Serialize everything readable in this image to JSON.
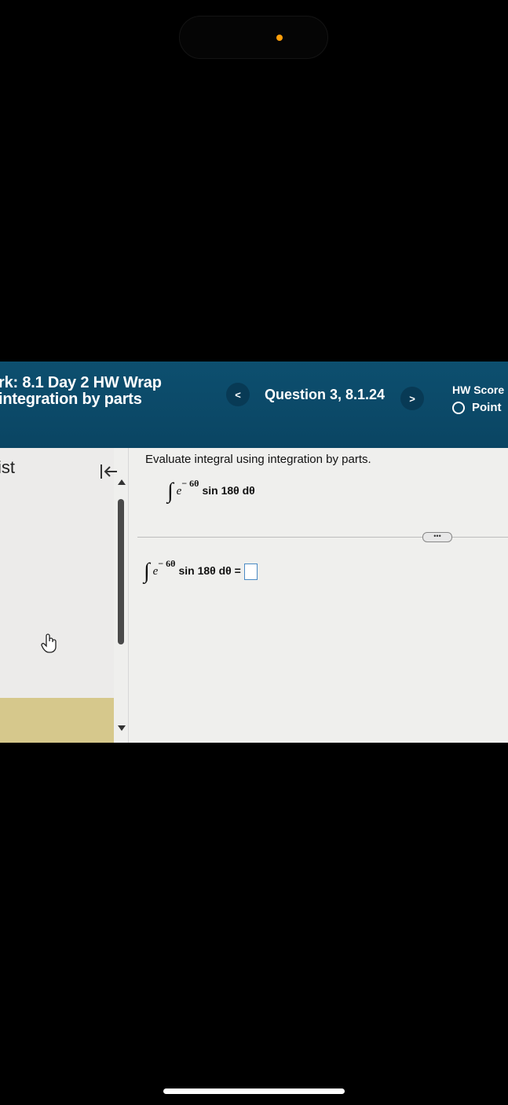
{
  "header": {
    "title_line1": "rk:  8.1 Day 2 HW Wrap",
    "title_line2": "integration by parts",
    "question_label": "Question 3, 8.1.24",
    "prev_label": "<",
    "next_label": ">",
    "score_label": "HW Score",
    "points_label": "Point"
  },
  "sidebar": {
    "label": "ist"
  },
  "problem": {
    "instruction": "Evaluate integral using integration by parts.",
    "integral_sign": "∫",
    "base": "e",
    "exponent": "− 6θ",
    "integrand_rest": "sin 18θ dθ",
    "answer_equals": "sin 18θ dθ ="
  },
  "more_button": "•••"
}
